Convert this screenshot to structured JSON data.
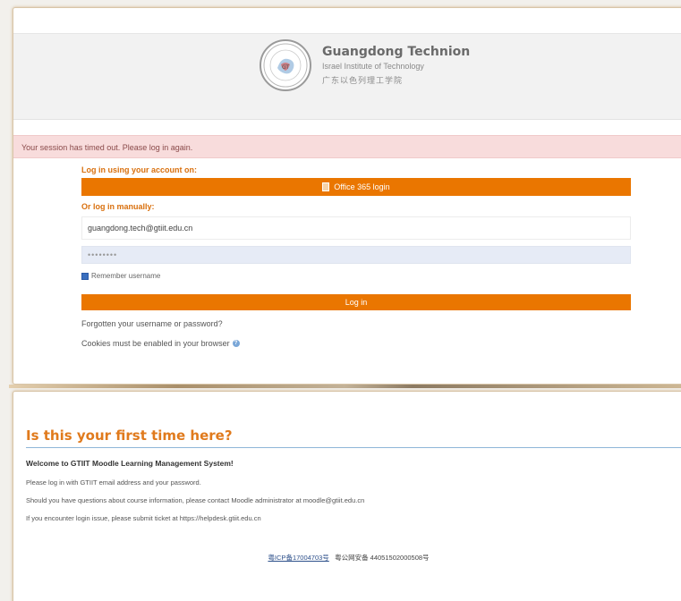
{
  "header": {
    "institution_name": "Guangdong Technion",
    "institution_subtitle": "Israel Institute of Technology",
    "institution_chinese": "广东以色列理工学院"
  },
  "alert": {
    "message": "Your session has timed out. Please log in again."
  },
  "login": {
    "heading": "Log in using your account on:",
    "office_button": "Office 365 login",
    "manual_heading": "Or log in manually:",
    "username_value": "guangdong.tech@gtiit.edu.cn",
    "password_value": "••••••••",
    "remember_label": "Remember username",
    "login_button": "Log in",
    "forgot_link": "Forgotten your username or password?",
    "cookies_notice": "Cookies must be enabled in your browser"
  },
  "first_time": {
    "title": "Is this your first time here?",
    "welcome": "Welcome to GTIIT Moodle Learning Management System!",
    "line1": "Please log in with GTIIT email address and your password.",
    "line2": "Should you have questions about course information, please contact Moodle administrator at moodle@gtiit.edu.cn",
    "line3": "If you encounter login issue, please submit ticket at https://helpdesk.gtiit.edu.cn"
  },
  "footer": {
    "icp": "粤ICP备17004703号",
    "police": "粤公网安备 44051502000508号"
  },
  "colors": {
    "accent_orange": "#ea7600",
    "title_orange": "#e07a1c",
    "alert_bg": "#f8dcdc",
    "password_bg": "#e6ebf6"
  },
  "icons": {
    "logo": "university-seal-icon",
    "office": "office-icon",
    "help": "question-circle-icon",
    "checkbox": "checkbox-checked-icon"
  }
}
